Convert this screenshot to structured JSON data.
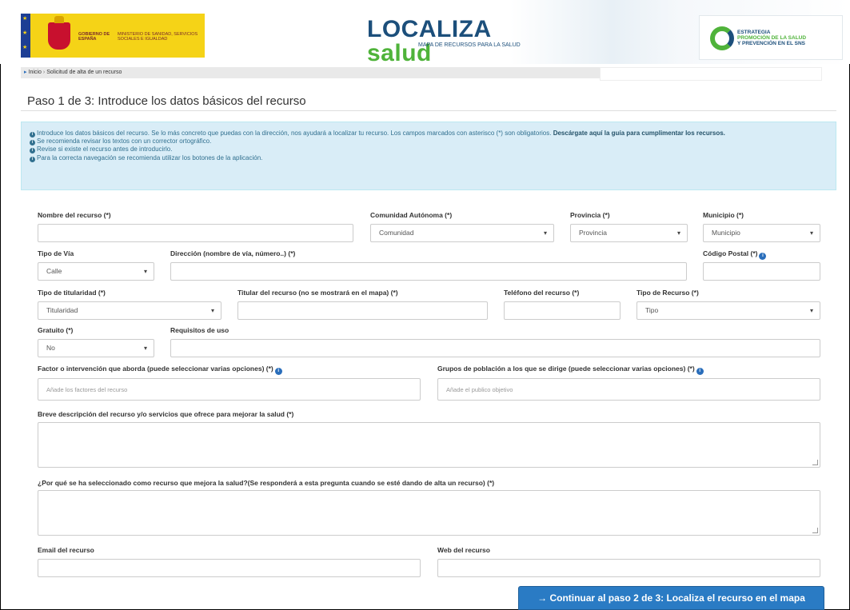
{
  "header": {
    "gov_line1": "GOBIERNO DE ESPAÑA",
    "gov_line2": "MINISTERIO DE SANIDAD, SERVICIOS SOCIALES E IGUALDAD",
    "logo_main_a": "LOCALIZA",
    "logo_main_b": "salud",
    "logo_sub": "MAPA DE RECURSOS PARA LA SALUD",
    "strategy_line1": "ESTRATEGIA",
    "strategy_line2": "PROMOCIÓN DE LA SALUD",
    "strategy_line3": "Y PREVENCIÓN EN EL SNS"
  },
  "breadcrumb": {
    "home": "Inicio",
    "current": "Solicitud de alta de un recurso"
  },
  "page_title": "Paso 1 de 3: Introduce los datos básicos del recurso",
  "alert": {
    "line1": "Introduce los datos básicos del recurso. Se lo más concreto que puedas con la dirección, nos ayudará a localizar tu recurso. Los campos marcados con asterisco (*) son obligatorios.",
    "line1_link": "Descárgate aquí la guía para cumplimentar los recursos.",
    "line2": "Se recomienda revisar los textos con un corrector ortográfico.",
    "line3": "Revise si existe el recurso antes de introducirlo.",
    "line4": "Para la correcta navegación se recomienda utilizar los botones de la aplicación."
  },
  "form": {
    "nombre_label": "Nombre del recurso (*)",
    "nombre_value": "",
    "comunidad_label": "Comunidad Autónoma (*)",
    "comunidad_value": "Comunidad",
    "provincia_label": "Provincia (*)",
    "provincia_value": "Provincia",
    "municipio_label": "Municipio (*)",
    "municipio_value": "Municipio",
    "tipo_via_label": "Tipo de Vía",
    "tipo_via_value": "Calle",
    "direccion_label": "Dirección (nombre de vía, número..) (*)",
    "cp_label": "Código Postal (*)",
    "titularidad_label": "Tipo de titularidad (*)",
    "titularidad_value": "Titularidad",
    "titular_label": "Titular del recurso (no se mostrará en el mapa) (*)",
    "telefono_label": "Teléfono del recurso (*)",
    "tipo_recurso_label": "Tipo de Recurso (*)",
    "tipo_recurso_value": "Tipo",
    "gratuito_label": "Gratuito (*)",
    "gratuito_value": "No",
    "requisitos_label": "Requisitos de uso",
    "factor_label": "Factor o intervención que aborda (puede seleccionar varias opciones) (*)",
    "factor_placeholder": "Añade los factores del recurso",
    "grupos_label": "Grupos de población a los que se dirige (puede seleccionar varias opciones) (*)",
    "grupos_placeholder": "Añade el publico objetivo",
    "descripcion_label": "Breve descripción del recurso y/o servicios que ofrece para mejorar la salud (*)",
    "porque_label": "¿Por qué se ha seleccionado como recurso que mejora la salud?(Se responderá a esta pregunta cuando se esté dando de alta un recurso) (*)",
    "email_label": "Email del recurso",
    "web_label": "Web del recurso"
  },
  "continue_button": "→ Continuar al paso 2 de 3: Localiza el recurso en el mapa"
}
